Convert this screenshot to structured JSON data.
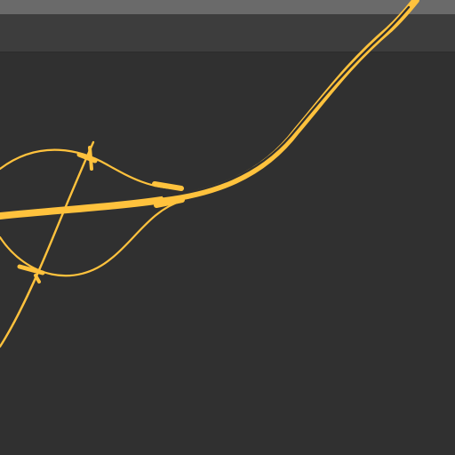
{
  "colors": {
    "background": "#303030",
    "window_strip": "#3d3d3d",
    "window_strip_top": "#6a6a6a",
    "curve": "#ffc23d",
    "curve_gap": "#303030"
  },
  "icons": {
    "curve_network": "curve-network-icon"
  }
}
